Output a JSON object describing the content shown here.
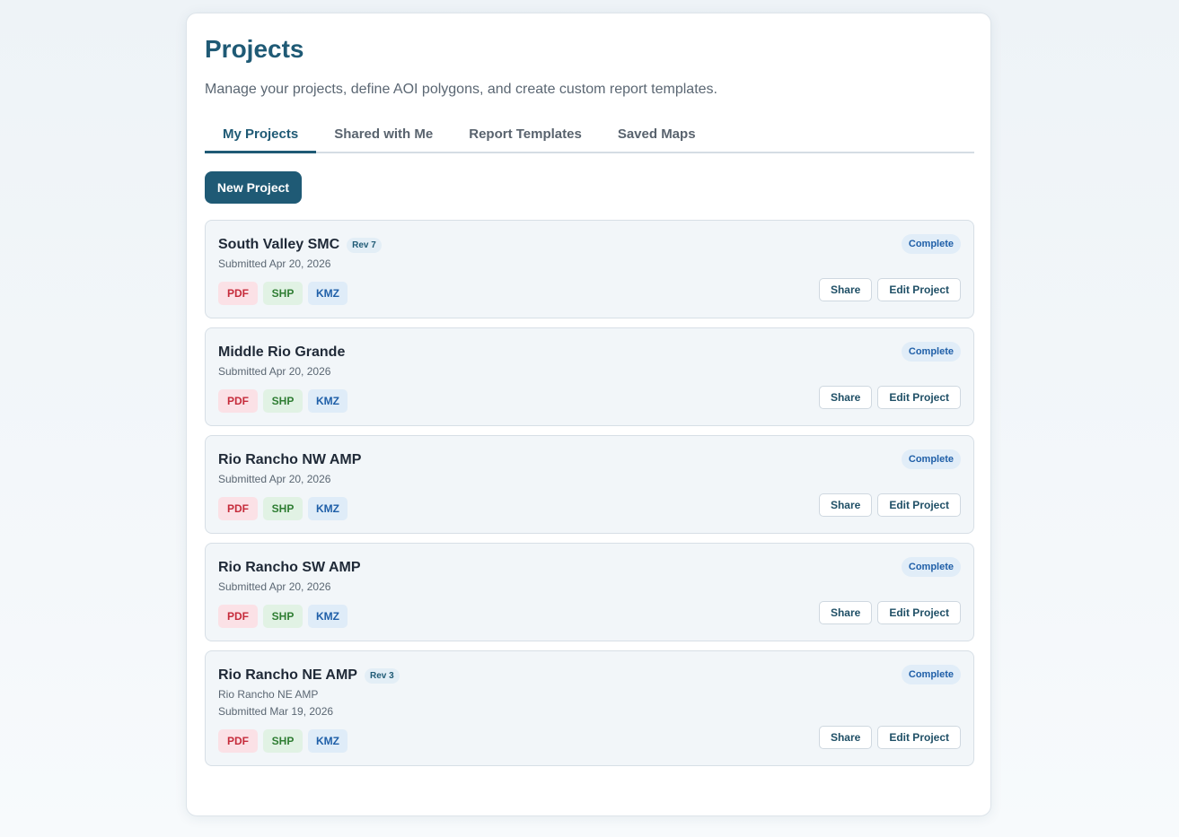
{
  "header": {
    "title": "Projects",
    "subtitle": "Manage your projects, define AOI polygons, and create custom report templates."
  },
  "tabs": [
    {
      "label": "My Projects",
      "active": true
    },
    {
      "label": "Shared with Me",
      "active": false
    },
    {
      "label": "Report Templates",
      "active": false
    },
    {
      "label": "Saved Maps",
      "active": false
    }
  ],
  "actions": {
    "new_project_label": "New Project"
  },
  "file_types": [
    "PDF",
    "SHP",
    "KMZ"
  ],
  "card_actions": {
    "share_label": "Share",
    "edit_label": "Edit Project"
  },
  "projects": [
    {
      "name": "South Valley SMC",
      "rev": "Rev 7",
      "description": "",
      "submitted": "Submitted Apr 20, 2026",
      "status": "Complete"
    },
    {
      "name": "Middle Rio Grande",
      "rev": "",
      "description": "",
      "submitted": "Submitted Apr 20, 2026",
      "status": "Complete"
    },
    {
      "name": "Rio Rancho NW AMP",
      "rev": "",
      "description": "",
      "submitted": "Submitted Apr 20, 2026",
      "status": "Complete"
    },
    {
      "name": "Rio Rancho SW AMP",
      "rev": "",
      "description": "",
      "submitted": "Submitted Apr 20, 2026",
      "status": "Complete"
    },
    {
      "name": "Rio Rancho NE AMP",
      "rev": "Rev 3",
      "description": "Rio Rancho NE AMP",
      "submitted": "Submitted Mar 19, 2026",
      "status": "Complete"
    }
  ],
  "colors": {
    "accent": "#1f5a75",
    "pdf": "#c62b3b",
    "shp": "#2e7d32",
    "kmz": "#1f5fa8",
    "status": "#1f5fa8"
  }
}
